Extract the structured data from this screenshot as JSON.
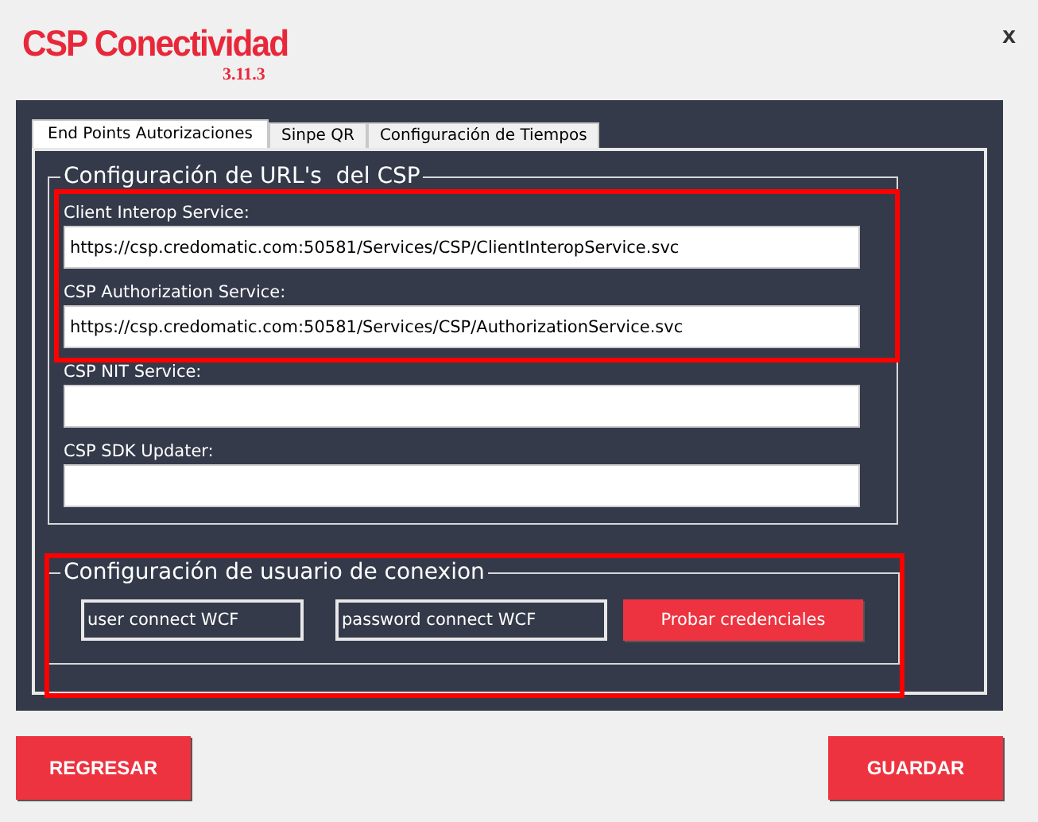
{
  "window": {
    "title": "CSP Conectividad",
    "version": "3.11.3",
    "close": "x"
  },
  "tabs": [
    {
      "label": "End Points Autorizaciones",
      "selected": true
    },
    {
      "label": "Sinpe QR",
      "selected": false
    },
    {
      "label": "Configuración de Tiempos",
      "selected": false
    }
  ],
  "url_group": {
    "title": "Configuración de URL's  del CSP",
    "fields": [
      {
        "label": "Client Interop Service:",
        "value": "https://csp.credomatic.com:50581/Services/CSP/ClientInteropService.svc"
      },
      {
        "label": "CSP Authorization Service:",
        "value": "https://csp.credomatic.com:50581/Services/CSP/AuthorizationService.svc"
      },
      {
        "label": "CSP NIT Service:"
      },
      {
        "label": "CSP SDK Updater:"
      }
    ]
  },
  "user_group": {
    "title": "Configuración de usuario de conexion",
    "user": "user connect WCF",
    "password": "password connect WCF",
    "test_button": "Probar credenciales"
  },
  "buttons": {
    "back": "REGRESAR",
    "save": "GUARDAR"
  }
}
